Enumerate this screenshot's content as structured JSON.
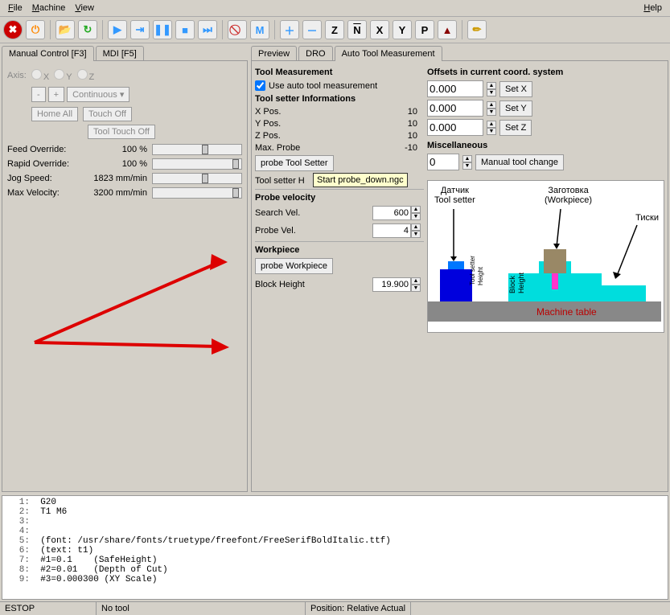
{
  "menu": {
    "file": "File",
    "machine": "Machine",
    "view": "View",
    "help": "Help"
  },
  "left_tabs": {
    "manual": "Manual Control [F3]",
    "mdi": "MDI [F5]"
  },
  "axis": {
    "label": "Axis:",
    "x": "X",
    "y": "Y",
    "z": "Z",
    "minus": "-",
    "plus": "+",
    "continuous": "Continuous",
    "homeall": "Home All",
    "touchoff": "Touch Off",
    "tooltouchoff": "Tool Touch Off"
  },
  "over": {
    "feed_lbl": "Feed Override:",
    "feed_val": "100 %",
    "rapid_lbl": "Rapid Override:",
    "rapid_val": "100 %",
    "jog_lbl": "Jog Speed:",
    "jog_val": "1823 mm/min",
    "max_lbl": "Max Velocity:",
    "max_val": "3200 mm/min"
  },
  "right_tabs": {
    "preview": "Preview",
    "dro": "DRO",
    "atm": "Auto Tool Measurement"
  },
  "tm": {
    "hdr": "Tool Measurement",
    "chk": "Use auto tool measurement",
    "setter_hdr": "Tool setter Informations",
    "xpos_lbl": "X Pos.",
    "xpos_val": "10",
    "ypos_lbl": "Y Pos.",
    "ypos_val": "10",
    "zpos_lbl": "Z Pos.",
    "zpos_val": "10",
    "max_lbl": "Max. Probe",
    "max_val": "-10",
    "probe_btn": "probe Tool Setter",
    "height_lbl": "Tool setter H",
    "tooltip": "Start probe_down.ngc",
    "pv_hdr": "Probe velocity",
    "search_lbl": "Search Vel.",
    "search_val": "600",
    "probe_lbl": "Probe Vel.",
    "probe_val": "4",
    "wp_hdr": "Workpiece",
    "wp_btn": "probe Workpiece",
    "bh_lbl": "Block Height",
    "bh_val": "19.900"
  },
  "off": {
    "hdr": "Offsets in current coord. system",
    "x": "0.000",
    "setx": "Set X",
    "y": "0.000",
    "sety": "Set Y",
    "z": "0.000",
    "setz": "Set Z"
  },
  "misc": {
    "hdr": "Miscellaneous",
    "val": "0",
    "btn": "Manual tool change"
  },
  "diag": {
    "sensor": "Датчик",
    "toolsetter": "Tool setter",
    "workpiece_ru": "Заготовка",
    "workpiece_en": "(Workpiece)",
    "vise": "Тиски",
    "tsh": "Tool setter Height",
    "bh": "Block Height",
    "table": "Machine table"
  },
  "code": {
    "l1": "G20",
    "l2": "T1 M6",
    "l3": "",
    "l4": "",
    "l5": "(font: /usr/share/fonts/truetype/freefont/FreeSerifBoldItalic.ttf)",
    "l6": "(text: t1)",
    "l7": "#1=0.1    (SafeHeight)",
    "l8": "#2=0.01   (Depth of Cut)",
    "l9": "#3=0.000300 (XY Scale)"
  },
  "status": {
    "estop": "ESTOP",
    "tool": "No tool",
    "pos": "Position: Relative Actual"
  },
  "icons": {
    "z": "Z",
    "n": "N",
    "x": "X",
    "y": "Y",
    "p": "P"
  }
}
